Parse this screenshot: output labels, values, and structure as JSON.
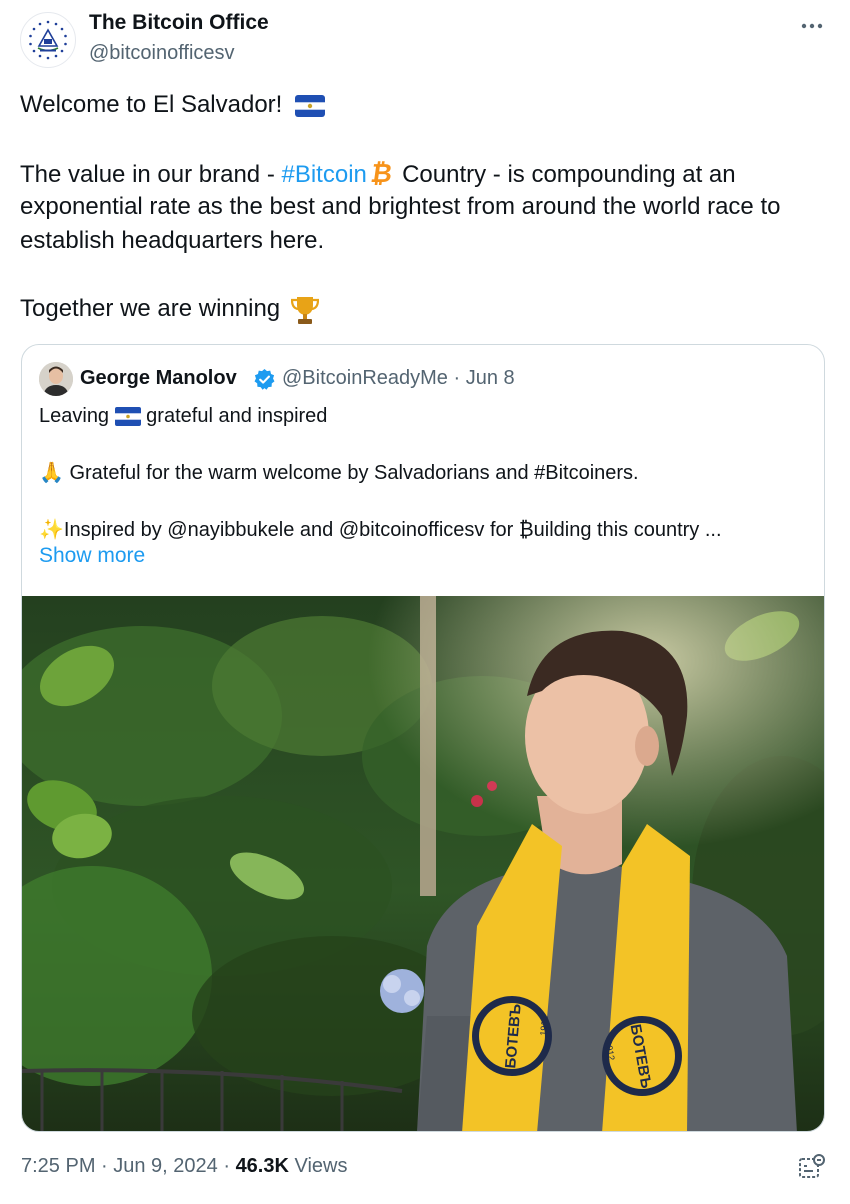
{
  "author": {
    "display_name": "The Bitcoin Office",
    "handle": "@bitcoinofficesv",
    "avatar_icon": "el-salvador-coat-of-arms-icon"
  },
  "more_icon": "more-horizontal-icon",
  "tweet": {
    "line1": "Welcome to El Salvador! ",
    "line2_prefix": "The value in our brand - ",
    "line2_hashtag": "#Bitcoin",
    "line2_btc_glyph": "₿",
    "line2_suffix": "Country - is compounding at an",
    "line3": "exponential rate as the best and brightest from around the world race to",
    "line4": "establish headquarters here.",
    "line5": "Together we are winning ",
    "flag_icon": "el-salvador-flag-icon",
    "trophy_icon": "trophy-icon"
  },
  "quote": {
    "author_name": "George Manolov",
    "verified_icon": "verified-badge-icon",
    "handle_date": "@BitcoinReadyMe · Jun 8",
    "line1_prefix": "Leaving ",
    "line1_suffix": " grateful and inspired",
    "line2_emoji": "🙏",
    "line2": " Grateful for the warm welcome by Salvadorians and #Bitcoiners.",
    "line3_emoji": "✨",
    "line3": "Inspired by @nayibbukele and @bitcoinofficesv for ₿uilding this country ...",
    "show_more": "Show more",
    "media": "photo-man-in-garden-yellow-scarf",
    "scarf_text_1": "БОТЕВЪ",
    "scarf_text_2": "1912"
  },
  "footer": {
    "time_date": "7:25 PM · Jun 9, 2024 · ",
    "views_count": "46.3K",
    "views_label": " Views",
    "analytics_icon": "analytics-icon"
  },
  "colors": {
    "link": "#1d9bf0",
    "muted": "#536471",
    "text": "#0f1419",
    "bitcoin": "#f7931a",
    "border": "#cfd9de",
    "scarf_yellow": "#f3c326"
  }
}
